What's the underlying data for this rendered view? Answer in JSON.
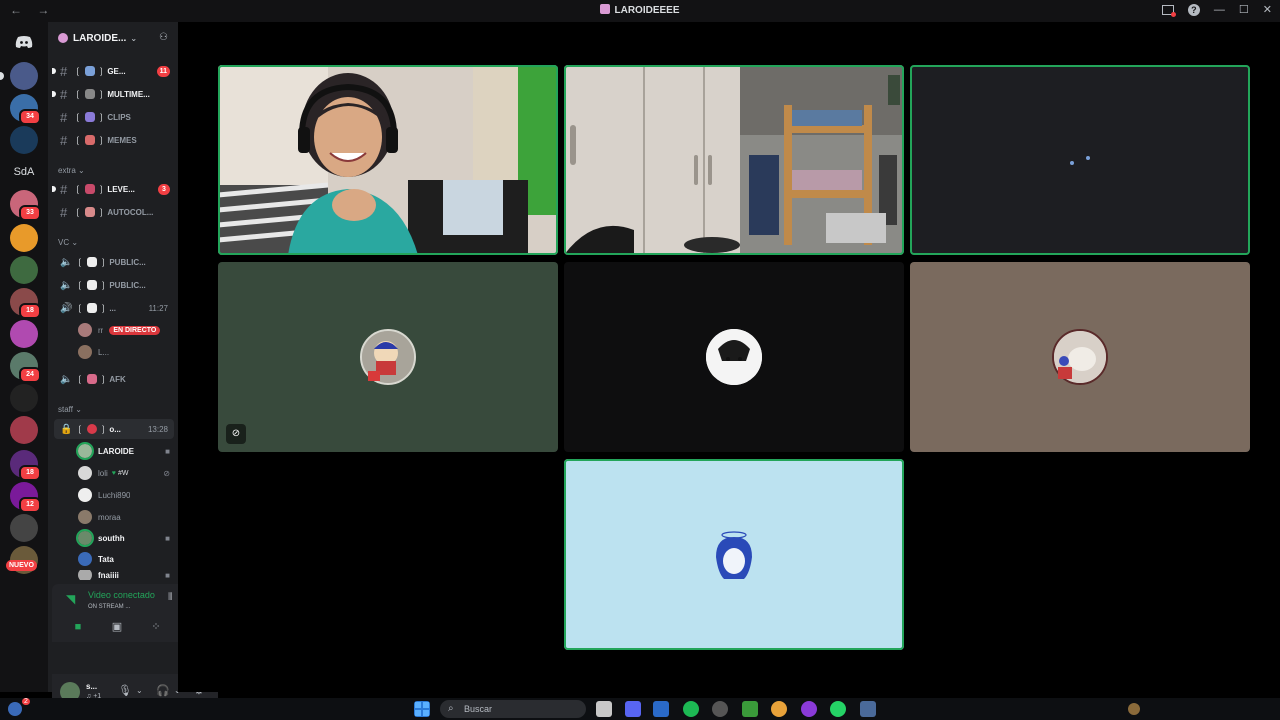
{
  "window": {
    "title": "LAROIDEEEE"
  },
  "guild": {
    "name": "LAROIDE..."
  },
  "rail": {
    "badges": [
      "34",
      "33",
      "18",
      "24",
      "18",
      "12"
    ],
    "sda_label": "SdA",
    "new_label": "NUEVO"
  },
  "channels": [
    {
      "name": "GE...",
      "badge": "11"
    },
    {
      "name": "MULTIME..."
    },
    {
      "name": "CLIPS"
    },
    {
      "name": "MEMES"
    }
  ],
  "categories": {
    "extra": "extra",
    "vc": "VC",
    "staff": "staff"
  },
  "extra_channels": [
    {
      "name": "LEVE...",
      "badge": "3"
    },
    {
      "name": "AUTOCOL..."
    }
  ],
  "voice_channels": [
    {
      "name": "PUBLIC..."
    },
    {
      "name": "PUBLIC..."
    },
    {
      "name": "...",
      "time": "11:27"
    }
  ],
  "vc_users": [
    {
      "name": "rr",
      "live": "EN DIRECTO"
    },
    {
      "name": "L..."
    }
  ],
  "afk_channel": {
    "name": "AFK"
  },
  "staff_channel": {
    "name": "o...",
    "time": "13:28"
  },
  "staff_users": [
    {
      "name": "LAROIDE"
    },
    {
      "name": "loli",
      "extra": "#W"
    },
    {
      "name": "Luchi890"
    },
    {
      "name": "moraa"
    },
    {
      "name": "southh"
    },
    {
      "name": "Tata"
    },
    {
      "name": "fnaiiii"
    }
  ],
  "voice_panel": {
    "title": "Video conectado",
    "subtitle": "ON STREAM ..."
  },
  "user_bar": {
    "name": "s...",
    "status": "♫ +1"
  },
  "taskbar": {
    "search_placeholder": "Buscar",
    "notif_count": "2"
  },
  "colors": {
    "speaking_outline": "#23a55a",
    "accent_red": "#f23f43"
  }
}
